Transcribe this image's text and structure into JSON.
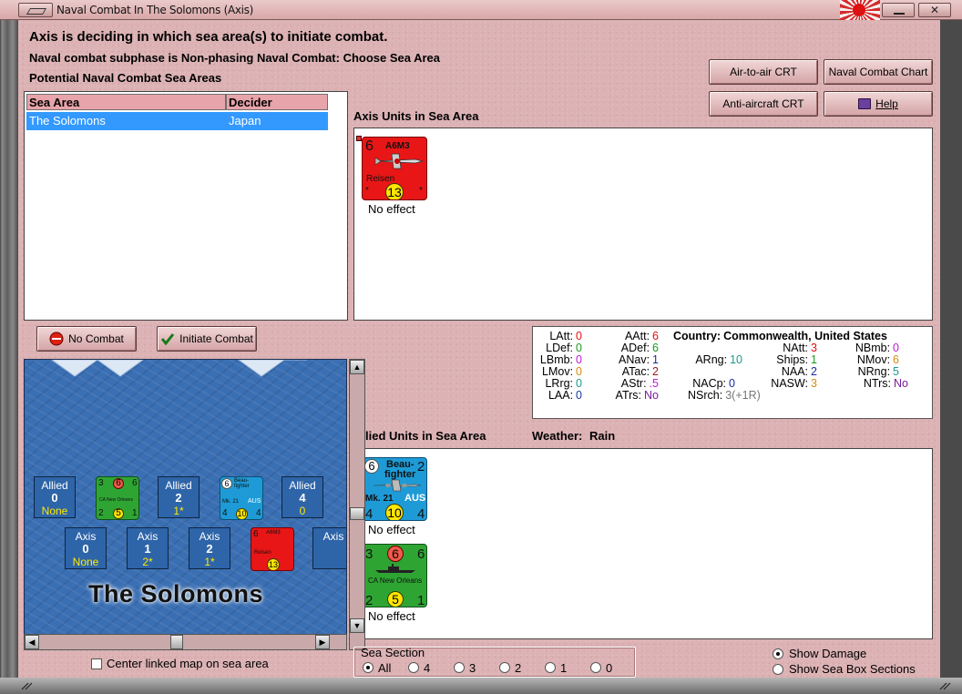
{
  "window": {
    "title": "Naval Combat In The Solomons (Axis)"
  },
  "header": {
    "line1": "Axis is deciding in which sea area(s) to initiate combat.",
    "line2": "Naval combat subphase is Non-phasing Naval Combat: Choose Sea Area",
    "line3": "Potential Naval Combat Sea Areas"
  },
  "buttons": {
    "air_to_air": "Air-to-air CRT",
    "naval_chart": "Naval Combat Chart",
    "anti_aircraft": "Anti-aircraft CRT",
    "help": "Help",
    "no_combat": "No Combat",
    "initiate_combat": "Initiate Combat"
  },
  "sea_table": {
    "columns": [
      "Sea Area",
      "Decider"
    ],
    "rows": [
      {
        "sea_area": "The Solomons",
        "decider": "Japan"
      }
    ]
  },
  "axis_units": {
    "label": "Axis Units in Sea Area",
    "units": [
      {
        "name": "A6M3",
        "subname": "Reisen",
        "top_left": "6",
        "circle": "13",
        "effect": "No effect",
        "corner": "*"
      }
    ]
  },
  "stats": {
    "latt": "0",
    "ldef": "0",
    "lbmb": "0",
    "lmov": "0",
    "lrrg": "0",
    "laa": "0",
    "aatt": "6",
    "adef": "6",
    "anav": "1",
    "atac": "2",
    "astr": ".5",
    "atrs": "No",
    "arng": "10",
    "nacp": "0",
    "nsrch": "3(+1R)",
    "country_label": "Country:",
    "country": "Commonwealth, United States",
    "natt": "3",
    "ships": "1",
    "naa": "2",
    "nasw": "3",
    "nbmb": "0",
    "nmov": "6",
    "nrng": "5",
    "ntrs": "No",
    "labels": {
      "latt": "LAtt:",
      "ldef": "LDef:",
      "lbmb": "LBmb:",
      "lmov": "LMov:",
      "lrrg": "LRrg:",
      "laa": "LAA:",
      "aatt": "AAtt:",
      "adef": "ADef:",
      "anav": "ANav:",
      "atac": "ATac:",
      "astr": "AStr:",
      "atrs": "ATrs:",
      "arng": "ARng:",
      "nacp": "NACp:",
      "nsrch": "NSrch:",
      "natt": "NAtt:",
      "ships": "Ships:",
      "naa": "NAA:",
      "nasw": "NASW:",
      "nbmb": "NBmb:",
      "nmov": "NMov:",
      "nrng": "NRng:",
      "ntrs": "NTrs:"
    }
  },
  "allied_units": {
    "label": "Allied Units in Sea Area",
    "weather_label": "Weather:",
    "weather": "Rain",
    "units": [
      {
        "type": "aircraft",
        "name_line1": "Beau-",
        "name_line2": "fighter",
        "mark": "Mk. 21",
        "nation": "AUS",
        "top_left": "6",
        "top_right": "2",
        "bottom_left": "4",
        "circle": "10",
        "bottom_right": "4",
        "effect": "No effect"
      },
      {
        "type": "ship",
        "name": "CA New Orleans",
        "top_left": "3",
        "top_mid": "6",
        "top_right": "6",
        "bottom_left": "2",
        "circle": "5",
        "bottom_right": "1",
        "effect": "No effect"
      }
    ]
  },
  "map": {
    "title": "The Solomons",
    "allied_boxes": [
      {
        "side": "Allied",
        "num": "0",
        "sub": "None"
      },
      {
        "side": "Allied",
        "num": "2",
        "sub": "1*"
      },
      {
        "side": "Allied",
        "num": "4",
        "sub": "0"
      }
    ],
    "axis_boxes": [
      {
        "side": "Axis",
        "num": "0",
        "sub": "None"
      },
      {
        "side": "Axis",
        "num": "1",
        "sub": "2*"
      },
      {
        "side": "Axis",
        "num": "2",
        "sub": "1*"
      },
      {
        "side": "Axis",
        "num": "",
        "sub": ""
      }
    ],
    "small_ship": {
      "name": "CA New Orleans",
      "a": "3",
      "b": "6",
      "c": "6",
      "d": "2",
      "e": "5",
      "f": "1"
    },
    "small_beau": {
      "top": "6",
      "name": "Beau-fighter",
      "mark": "Mk. 21",
      "nation": "AUS",
      "a": "4",
      "circle": "10",
      "b": "4"
    },
    "small_axis": {
      "top": "6",
      "name": "A6M3",
      "sub": "Reisen",
      "circle": "13"
    }
  },
  "options": {
    "center_map": "Center linked map on sea area",
    "sea_section": "Sea Section",
    "sections": [
      "All",
      "4",
      "3",
      "2",
      "1",
      "0"
    ],
    "show_damage": "Show Damage",
    "show_boxes": "Show Sea Box Sections"
  },
  "colors": {
    "background": "#dcb2b4",
    "axis_counter": "#e81616",
    "allied_air": "#1e9bd6",
    "allied_ship": "#2ea533",
    "selection": "#3399ff"
  }
}
